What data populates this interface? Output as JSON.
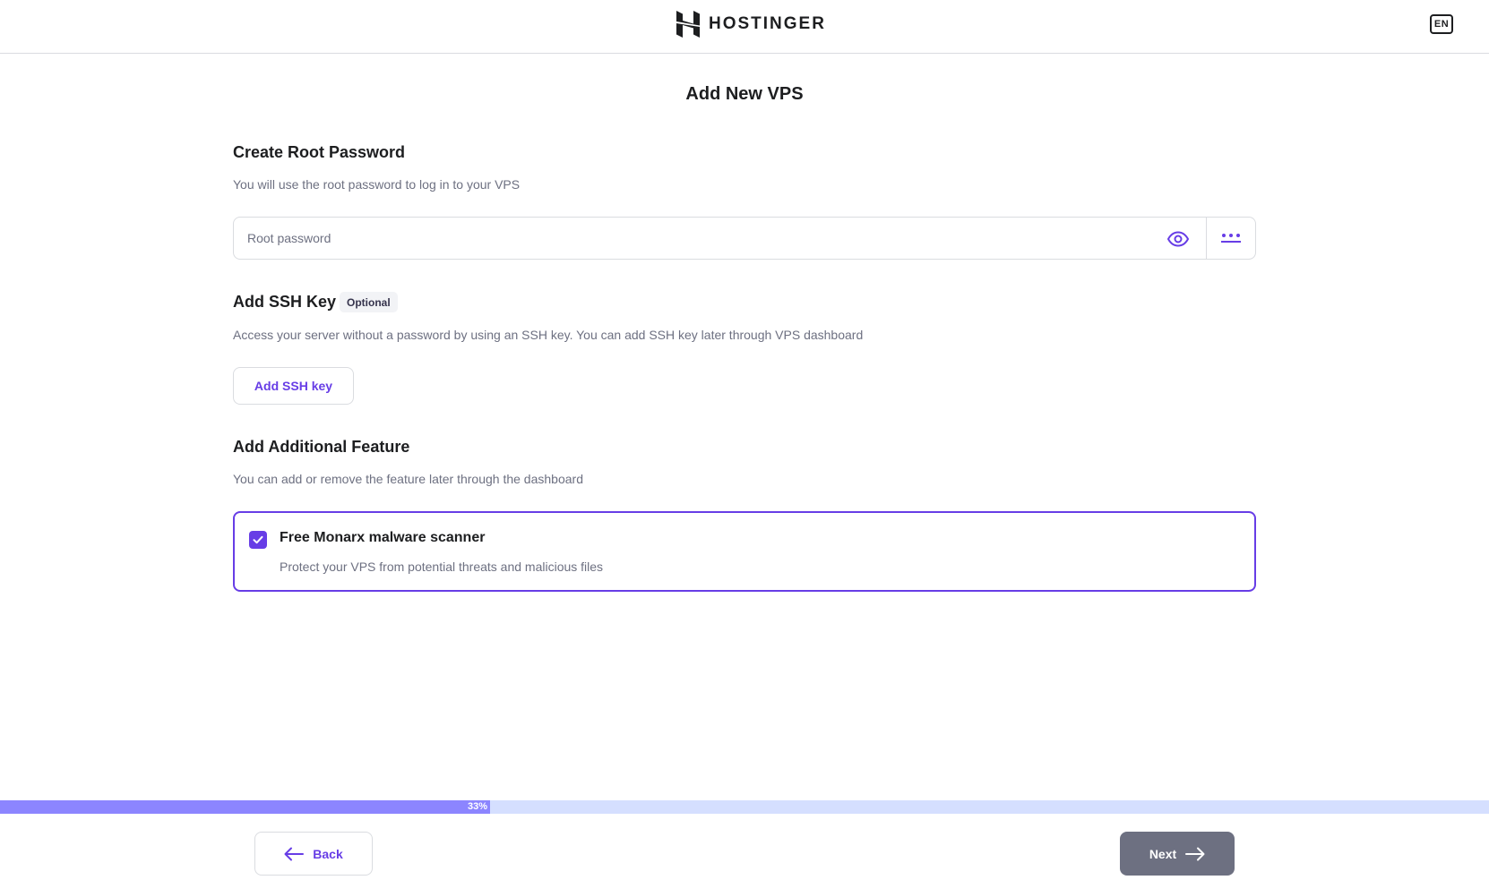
{
  "header": {
    "brand": "HOSTINGER",
    "language": "EN"
  },
  "page": {
    "title": "Add New VPS"
  },
  "root_password": {
    "title": "Create Root Password",
    "description": "You will use the root password to log in to your VPS",
    "placeholder": "Root password",
    "value": "",
    "show_icon": "eye-icon",
    "generate_icon": "password-dots-icon"
  },
  "ssh_key": {
    "title": "Add SSH Key",
    "badge": "Optional",
    "description": "Access your server without a password by using an SSH key. You can add SSH key later through VPS dashboard",
    "button_label": "Add SSH key"
  },
  "additional_feature": {
    "title": "Add Additional Feature",
    "description": "You can add or remove the feature later through the dashboard",
    "feature": {
      "title": "Free Monarx malware scanner",
      "description": "Protect your VPS from potential threats and malicious files",
      "checked": true
    }
  },
  "progress": {
    "percent": 33,
    "label": "33%"
  },
  "footer": {
    "back_label": "Back",
    "next_label": "Next"
  },
  "colors": {
    "accent": "#673de6",
    "progress_fill": "#8c85ff",
    "progress_track": "#d5dfff",
    "next_disabled": "#6d7081"
  }
}
